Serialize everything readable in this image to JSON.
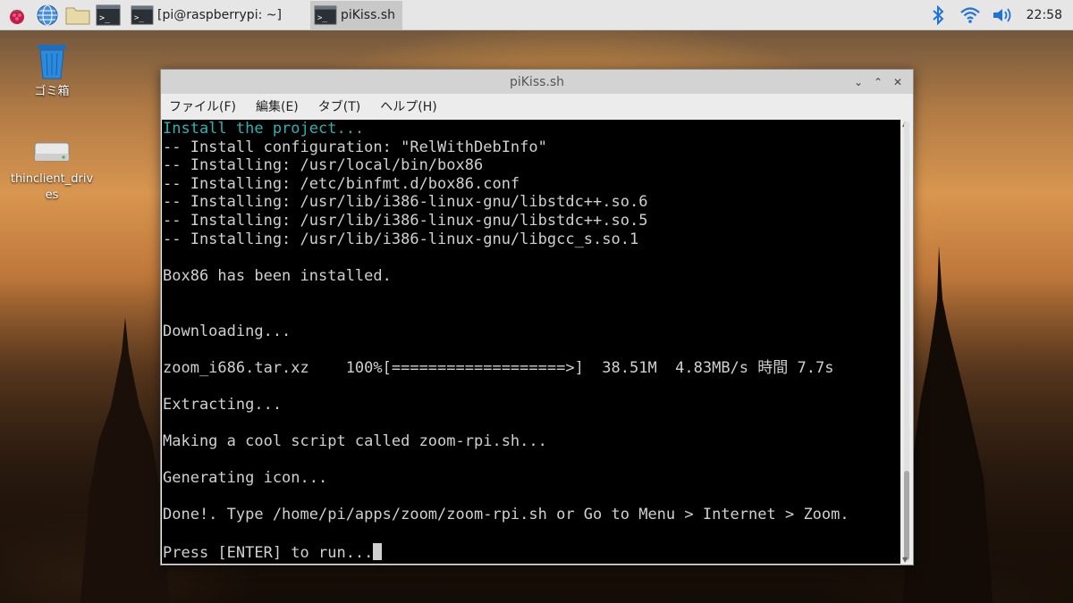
{
  "taskbar": {
    "buttons": [
      {
        "label": "[pi@raspberrypi: ~]"
      },
      {
        "label": "piKiss.sh"
      }
    ],
    "clock": "22:58"
  },
  "desktop": {
    "icons": [
      {
        "label": "ゴミ箱"
      },
      {
        "label": "thinclient_drives"
      }
    ]
  },
  "window": {
    "title": "piKiss.sh",
    "menu": [
      "ファイル(F)",
      "編集(E)",
      "タブ(T)",
      "ヘルプ(H)"
    ],
    "lines": [
      "Install the project...",
      "-- Install configuration: \"RelWithDebInfo\"",
      "-- Installing: /usr/local/bin/box86",
      "-- Installing: /etc/binfmt.d/box86.conf",
      "-- Installing: /usr/lib/i386-linux-gnu/libstdc++.so.6",
      "-- Installing: /usr/lib/i386-linux-gnu/libstdc++.so.5",
      "-- Installing: /usr/lib/i386-linux-gnu/libgcc_s.so.1",
      "",
      "Box86 has been installed.",
      "",
      "",
      "Downloading...",
      "",
      "zoom_i686.tar.xz    100%[===================>]  38.51M  4.83MB/s 時間 7.7s",
      "",
      "Extracting...",
      "",
      "Making a cool script called zoom-rpi.sh...",
      "",
      "Generating icon...",
      "",
      "Done!. Type /home/pi/apps/zoom/zoom-rpi.sh or Go to Menu > Internet > Zoom.",
      "",
      "Press [ENTER] to run..."
    ]
  }
}
